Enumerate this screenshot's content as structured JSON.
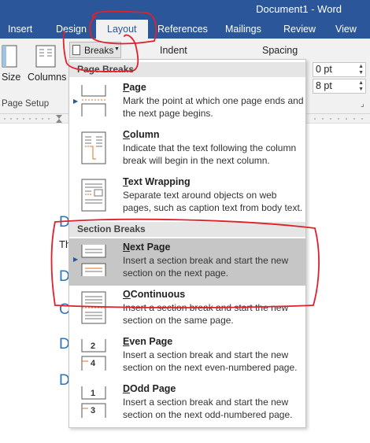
{
  "window": {
    "title": "Document1 - Word"
  },
  "tabs": [
    {
      "label": "Insert"
    },
    {
      "label": "Design"
    },
    {
      "label": "Layout"
    },
    {
      "label": "References"
    },
    {
      "label": "Mailings"
    },
    {
      "label": "Review"
    },
    {
      "label": "View"
    }
  ],
  "ribbon": {
    "size_label": "Size",
    "columns_label": "Columns",
    "breaks_label": "Breaks",
    "indent_label": "Indent",
    "spacing_label": "Spacing",
    "spacing_before": "0 pt",
    "spacing_after": "8 pt",
    "page_setup_label": "Page Setup"
  },
  "document": {
    "chars": [
      "D",
      "Th",
      "D",
      "C",
      "D",
      "D"
    ]
  },
  "menu": {
    "page_breaks_header": "Page Breaks",
    "section_breaks_header": "Section Breaks",
    "items": [
      {
        "title_u": "P",
        "title_rest": "age",
        "desc": "Mark the point at which one page ends and the next page begins.",
        "icon": "page-break-icon"
      },
      {
        "title_u": "C",
        "title_rest": "olumn",
        "desc": "Indicate that the text following the column break will begin in the next column.",
        "icon": "column-break-icon"
      },
      {
        "title_u": "T",
        "title_rest": "ext Wrapping",
        "desc": "Separate text around objects on web pages, such as caption text from body text.",
        "icon": "text-wrapping-break-icon"
      },
      {
        "title_u": "N",
        "title_rest": "ext Page",
        "desc": "Insert a section break and start the new section on the next page.",
        "icon": "next-page-break-icon"
      },
      {
        "title_u": "O",
        "title_rest": "Continuous",
        "desc": "Insert a section break and start the new section on the same page.",
        "icon": "continuous-break-icon"
      },
      {
        "title_u": "E",
        "title_rest": "ven Page",
        "desc": "Insert a section break and start the new section on the next even-numbered page.",
        "icon": "even-page-break-icon"
      },
      {
        "title_u": "D",
        "title_rest": "Odd Page",
        "desc": "Insert a section break and start the new section on the next odd-numbered page.",
        "icon": "odd-page-break-icon"
      }
    ]
  },
  "colors": {
    "accent": "#2b579a",
    "annotation": "#e0202a",
    "highlight": "#c6c6c6"
  }
}
